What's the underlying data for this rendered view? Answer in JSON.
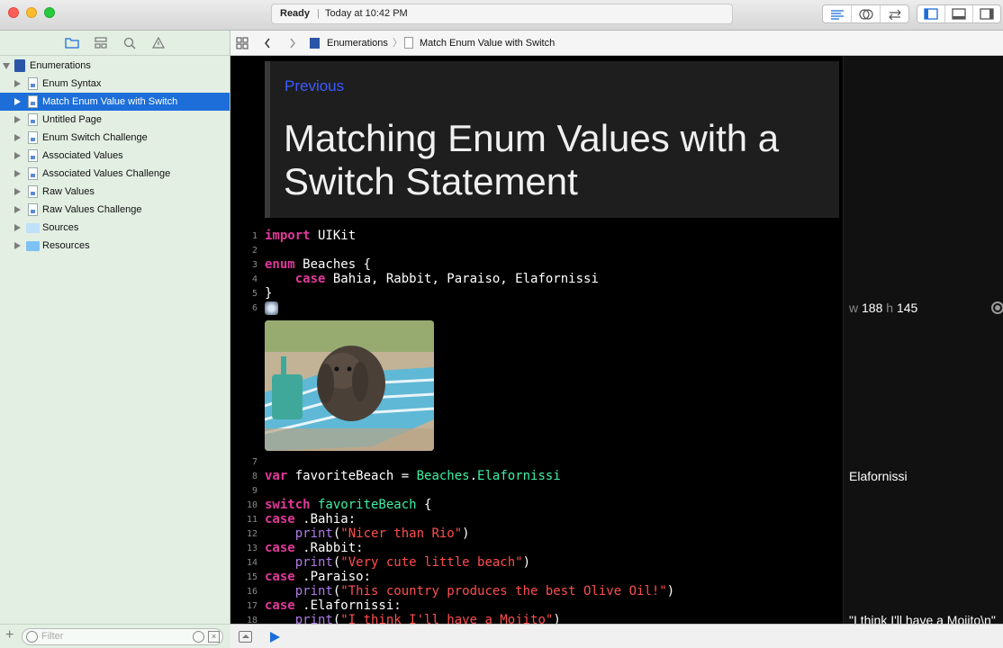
{
  "status": {
    "ready": "Ready",
    "separator": "|",
    "time": "Today at 10:42 PM"
  },
  "navigator": {
    "project": "Enumerations",
    "items": [
      {
        "label": "Enum Syntax",
        "kind": "page"
      },
      {
        "label": "Match Enum Value with Switch",
        "kind": "page",
        "selected": true
      },
      {
        "label": "Untitled Page",
        "kind": "page"
      },
      {
        "label": "Enum Switch Challenge",
        "kind": "page"
      },
      {
        "label": "Associated Values",
        "kind": "page"
      },
      {
        "label": "Associated Values Challenge",
        "kind": "page"
      },
      {
        "label": "Raw Values",
        "kind": "page"
      },
      {
        "label": "Raw Values Challenge",
        "kind": "page"
      },
      {
        "label": "Sources",
        "kind": "folder"
      },
      {
        "label": "Resources",
        "kind": "folder"
      }
    ],
    "filter_placeholder": "Filter"
  },
  "jumpbar": {
    "project": "Enumerations",
    "page": "Match Enum Value with Switch"
  },
  "doc": {
    "previous": "Previous",
    "title": "Matching Enum Values with a Switch Statement"
  },
  "code": {
    "l1_kw": "import",
    "l1_rest": " UIKit",
    "l3_kw": "enum",
    "l3_rest": " Beaches {",
    "l4_kw": "    case",
    "l4_rest": " Bahia, Rabbit, Paraiso, Elafornissi",
    "l5": "}",
    "l8_kw": "var",
    "l8_rest": " favoriteBeach = ",
    "l8_type": "Beaches",
    "l8_dot": ".",
    "l8_case": "Elafornissi",
    "l10_kw": "switch",
    "l10_var": " favoriteBeach",
    "l10_rest": " {",
    "l11_kw": "case",
    "l11_rest": " .Bahia:",
    "l12_fn": "    print",
    "l12_p1": "(",
    "l12_str": "\"Nicer than Rio\"",
    "l12_p2": ")",
    "l13_kw": "case",
    "l13_rest": " .Rabbit:",
    "l14_fn": "    print",
    "l14_p1": "(",
    "l14_str": "\"Very cute little beach\"",
    "l14_p2": ")",
    "l15_kw": "case",
    "l15_rest": " .Paraiso:",
    "l16_fn": "    print",
    "l16_p1": "(",
    "l16_str": "\"This country produces the best Olive Oil!\"",
    "l16_p2": ")",
    "l17_kw": "case",
    "l17_rest": " .Elafornissi:",
    "l18_fn": "    print",
    "l18_p1": "(",
    "l18_str": "\"I think I'll have a Mojito\"",
    "l18_p2": ")"
  },
  "line_numbers": [
    "1",
    "2",
    "3",
    "4",
    "5",
    "6",
    "7",
    "8",
    "9",
    "10",
    "11",
    "12",
    "13",
    "14",
    "15",
    "16",
    "17",
    "18"
  ],
  "results": {
    "w_key": "w",
    "w_val": "188",
    "h_key": "h",
    "h_val": "145",
    "beach": "Elafornissi",
    "print": "\"I think I'll have a Mojito\\n\""
  },
  "colors": {
    "keyword": "#e0399a",
    "type": "#3ff0a3",
    "string": "#ff4e4e",
    "function": "#b07be8",
    "selection": "#1d6ed8",
    "link": "#3d5bff"
  },
  "icons": [
    "folder-icon",
    "hierarchy-icon",
    "search-icon",
    "warning-icon",
    "grid-icon",
    "back-icon",
    "forward-icon",
    "play-icon",
    "quicklook-eye-icon"
  ]
}
